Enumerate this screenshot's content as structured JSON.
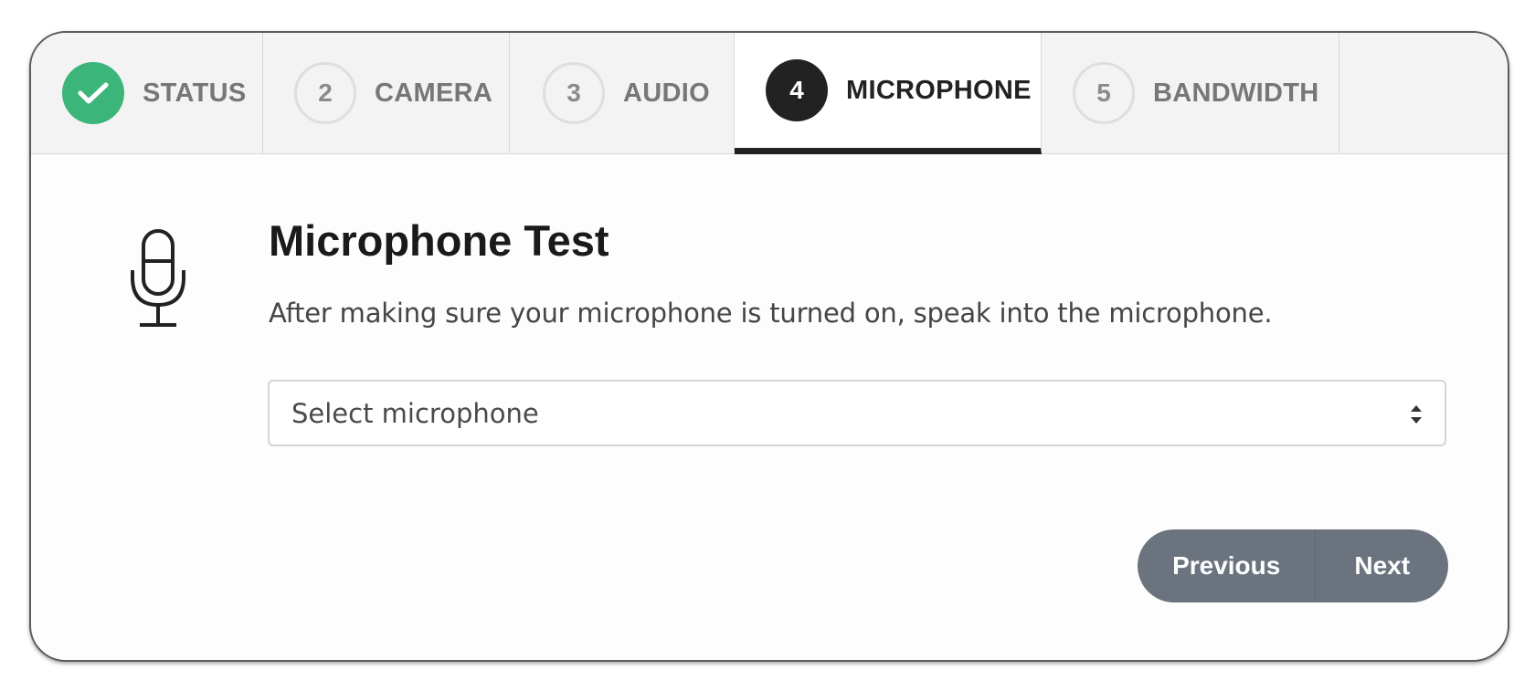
{
  "tabs": [
    {
      "step": "",
      "label": "STATUS",
      "state": "done",
      "icon": "check-icon"
    },
    {
      "step": "2",
      "label": "CAMERA",
      "state": "pending"
    },
    {
      "step": "3",
      "label": "AUDIO",
      "state": "pending"
    },
    {
      "step": "4",
      "label": "MICROPHONE",
      "state": "current"
    },
    {
      "step": "5",
      "label": "BANDWIDTH",
      "state": "pending"
    }
  ],
  "main": {
    "icon": "microphone-icon",
    "title": "Microphone Test",
    "description": "After making sure your microphone is turned on, speak into the microphone.",
    "select": {
      "value": "Select microphone"
    }
  },
  "actions": {
    "previous_label": "Previous",
    "next_label": "Next"
  },
  "colors": {
    "done": "#3cb57a",
    "current": "#222222",
    "button": "#6b747e"
  }
}
